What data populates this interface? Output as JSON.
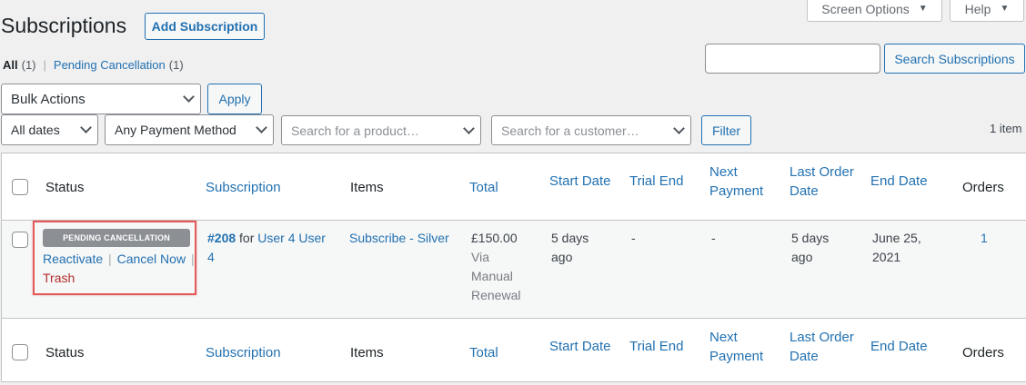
{
  "header": {
    "title": "Subscriptions",
    "add_button": "Add Subscription",
    "screen_options": "Screen Options",
    "help": "Help"
  },
  "views": {
    "all_label": "All",
    "all_count": "(1)",
    "pending_label": "Pending Cancellation",
    "pending_count": "(1)"
  },
  "search": {
    "value": "",
    "button": "Search Subscriptions"
  },
  "bulk": {
    "selected": "Bulk Actions",
    "apply": "Apply"
  },
  "filters": {
    "dates": "All dates",
    "payment_method": "Any Payment Method",
    "product_placeholder": "Search for a product…",
    "customer_placeholder": "Search for a customer…",
    "filter_button": "Filter"
  },
  "items_count": "1 item",
  "columns": {
    "status": "Status",
    "subscription": "Subscription",
    "items": "Items",
    "total": "Total",
    "start_date": "Start Date",
    "trial_end": "Trial End",
    "next_payment_1": "Next",
    "next_payment_2": "Payment",
    "last_order_1": "Last Order",
    "last_order_2": "Date",
    "end_date": "End Date",
    "orders": "Orders"
  },
  "row": {
    "status_badge": "PENDING CANCELLATION",
    "action_reactivate": "Reactivate",
    "action_cancel": "Cancel Now",
    "action_trash": "Trash",
    "sub_id": "#208",
    "sub_for": "for",
    "sub_user_1": "User 4 User",
    "sub_user_2": "4",
    "item": "Subscribe - Silver",
    "total": "£150.00",
    "total_via_1": "Via",
    "total_via_2": "Manual",
    "total_via_3": "Renewal",
    "start_1": "5 days",
    "start_2": "ago",
    "trial_end": "-",
    "next_payment": "-",
    "last_order_1": "5 days",
    "last_order_2": "ago",
    "end_1": "June 25,",
    "end_2": "2021",
    "orders": "1"
  },
  "colors": {
    "link": "#2271b1",
    "badge_bg": "#8c8f94",
    "highlight": "#e35a5a",
    "trash": "#b32d2e"
  }
}
